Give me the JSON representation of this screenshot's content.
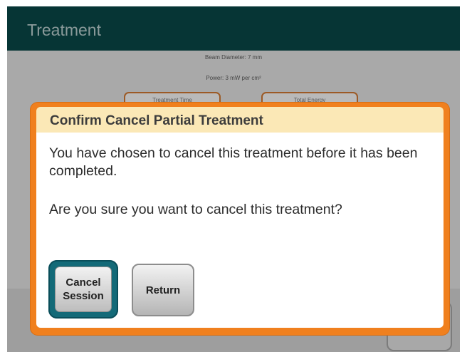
{
  "header": {
    "title": "Treatment"
  },
  "background_info": {
    "beam_diameter": "Beam Diameter: 7 mm",
    "power": "Power: 3 mW per cm²",
    "tile1_label": "Treatment Time",
    "tile2_label": "Total Energy"
  },
  "dialog": {
    "title": "Confirm Cancel Partial Treatment",
    "message1": "You have chosen to cancel this treatment before it has been completed.",
    "message2": "Are you sure you want to cancel this treatment?",
    "cancel_label": "Cancel\nSession",
    "return_label": "Return"
  },
  "colors": {
    "header": "#063535",
    "dialog_border": "#f0801e",
    "dialog_header": "#fbe8b6",
    "cancel_button": "#136a78"
  }
}
